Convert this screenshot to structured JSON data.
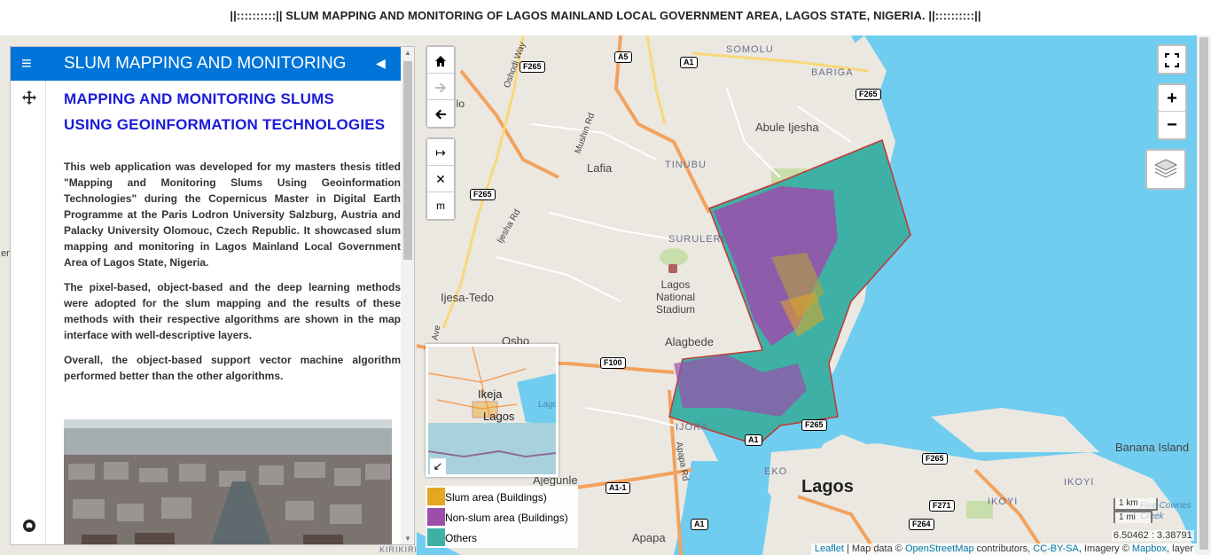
{
  "page": {
    "title": "||::::::::::|| SLUM MAPPING AND MONITORING OF LAGOS MAINLAND LOCAL GOVERNMENT AREA, LAGOS STATE, NIGERIA. ||::::::::::||"
  },
  "sidebar": {
    "header_title": "SLUM MAPPING AND MONITORING",
    "heading_line1": "MAPPING AND MONITORING SLUMS",
    "heading_line2": "USING GEOINFORMATION TECHNOLOGIES",
    "para1": "This web application was developed for my masters thesis titled \"Mapping and Monitoring Slums Using Geoinformation Technologies\" during the Copernicus Master in Digital Earth Programme at the Paris Lodron University Salzburg, Austria and Palacky University Olomouc, Czech Republic. It showcased slum mapping and monitoring in Lagos Mainland Local Government Area of Lagos State, Nigeria.",
    "para2": "The pixel-based, object-based and the deep learning methods were adopted for the slum mapping and the results of these methods with their respective algorithms are shown in the map interface with well-descriptive layers.",
    "para3": "Overall, the object-based support vector machine algorithm performed better than the other algorithms."
  },
  "controls": {
    "home_icon": "home-icon",
    "forward_icon": "arrow-right-icon",
    "back_icon": "arrow-left-icon",
    "measure_glyph": "↦",
    "clear_glyph": "✕",
    "unit_label": "m",
    "zoom_in": "+",
    "zoom_out": "−"
  },
  "legend": [
    {
      "label": "Slum area (Buildings)",
      "color": "#e5a623"
    },
    {
      "label": "Non-slum area (Buildings)",
      "color": "#9b4fab"
    },
    {
      "label": "Others",
      "color": "#3fb0a5"
    }
  ],
  "minimap": {
    "label_ikeja": "Ikeja",
    "label_lagos": "Lagos",
    "label_lago": "Lago"
  },
  "scale": {
    "km": "1 km",
    "mi": "1 mi"
  },
  "coords": "6.50462 : 3.38791",
  "attribution": {
    "leaflet": "Leaflet",
    "sep1": " | Map data © ",
    "osm": "OpenStreetMap",
    "contrib": " contributors, ",
    "license": "CC-BY-SA",
    "imagery": ", Imagery © ",
    "mapbox": "Mapbox",
    "tail": ", layer"
  },
  "map_labels": {
    "somolu": "SOMOLU",
    "bariga": "BARIGA",
    "abule": "Abule Ijesha",
    "lafia": "Lafia",
    "tinubu": "TINUBU",
    "surulere": "SURULERE",
    "stadium": "Lagos National Stadium",
    "ijesa": "Ijesa-Tedo",
    "alagbede": "Alagbede",
    "osho": "Osho",
    "ijora": "IJORA",
    "eko": "EKO",
    "lagos": "Lagos",
    "ikoyi1": "IKOYI",
    "ikoyi2": "IKOYI",
    "banana": "Banana Island",
    "ajegunle": "Ajegunle",
    "apapa": "Apapa",
    "oshodi_way": "Oshodi Way",
    "mushin_rd": "Mushin Rd",
    "ijesha_rd": "Ijesha Rd",
    "apapa_rd": "Apapa Rd",
    "olo": "olo",
    "ave": "Ave",
    "em": "em",
    "five_cowries": "Five Cowries Creek",
    "kirikiri": "KIRIKIRI"
  },
  "shields": {
    "f265a": "F265",
    "a5": "A5",
    "a1a": "A1",
    "f265b": "F265",
    "f265c": "F265",
    "f100": "F100",
    "a1b": "A1",
    "f265d": "F265",
    "a11": "A1-1",
    "a1c": "A1",
    "f271": "F271",
    "f264": "F264",
    "f265e": "F265"
  }
}
